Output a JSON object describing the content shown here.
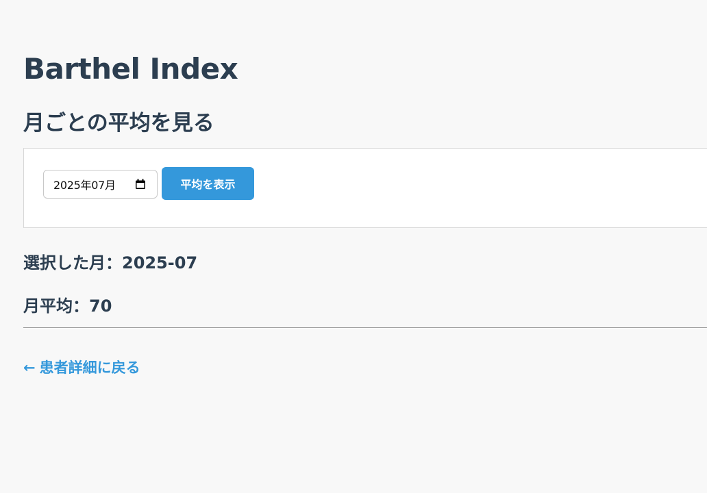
{
  "header": {
    "title": "Barthel Index",
    "subtitle": "月ごとの平均を見る"
  },
  "form": {
    "month_value": "2025年07月",
    "submit_label": "平均を表示"
  },
  "result": {
    "selected_month_label": "選択した月：",
    "selected_month_value": "2025-07",
    "average_label": "月平均：",
    "average_value": "70"
  },
  "footer": {
    "back_arrow": "←",
    "back_label": "患者詳細に戻る"
  },
  "colors": {
    "accent": "#3498db",
    "text": "#2c3e50",
    "background": "#f8f8f8"
  }
}
